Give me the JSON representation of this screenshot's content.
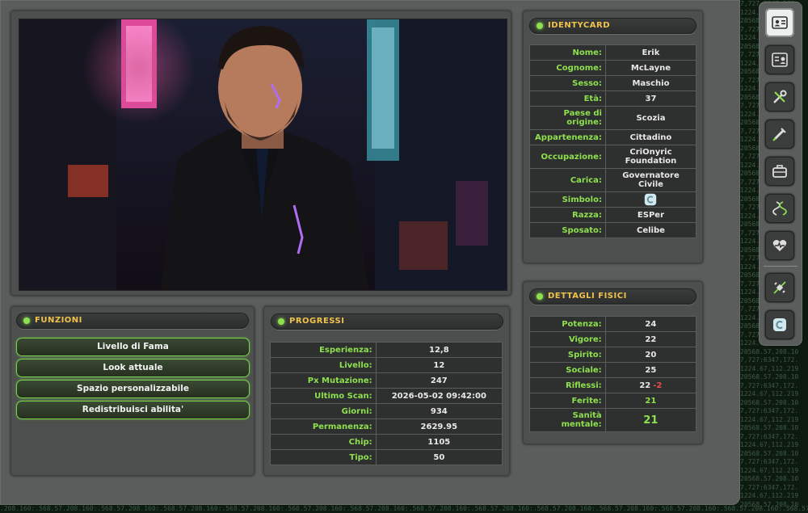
{
  "matrix": {
    "right_lines": [
      "7,727:6347,172.",
      "1224.67,112.219",
      "20568.57.208.10",
      "7,727:6347,172.",
      "1224.67,112.219",
      "20568.57.208.10",
      "7,727:6347,172.",
      "1224.67,112.219",
      "20568.57.208.10",
      "7,727:6347,172.",
      "1224.67,112.219",
      "20568.57.208.10",
      "7,727:6347,172.",
      "1224.67,112.219",
      "20568.57.208.10",
      "7,727:6347,172.",
      "1224.67,112.219",
      "20568.57.208.10",
      "7,727:6347,172.",
      "1224.67,112.219",
      "20568.57.208.10",
      "7,727:6347,172.",
      "1224.67,112.219",
      "20568.57.208.10",
      "7,727:6347,172.",
      "1224.67,112.219",
      "20568.57.208.10",
      "7,727:6347,172.",
      "1224.67,112.219",
      "20568.57.208.10",
      "7,727:6347,172.",
      "1224.67,112.219",
      "20568.57.208.10",
      "7,727:6347,172.",
      "1224.67,112.219",
      "20568.57.208.10",
      "7,727:6347,172.",
      "1224.67,112.219",
      "20568.57.208.10",
      "7,727:6347,172.",
      "1224.67,112.219",
      "20568.57.208.10",
      "7,727:6347,172.",
      "1224.67,112.219",
      "20568.57.208.10",
      "7,727:6347,172.",
      "1224.67,112.219",
      "20568.57.208.10",
      "7,727:6347,172.",
      "1224.67,112.219",
      "20568.57.208.10",
      "7,727:6347,172.",
      "1224.67,112.219",
      "20568.57.208.10",
      "7,727:6347,172.",
      "1224.67,112.219",
      "20568.57.208.10",
      "7,727:6347,172.",
      "1224.67,112.219",
      "20568.57.208.10"
    ],
    "bottom_line": ".208.160:.568.57.208.160:.568.57.208.160:.568.57.208.160:.568.57.208.160:.568.57.208.160:.568.57.208.160:.568.57.208.160:.568.57.208.160:.568.57.208.160:.568.57.208.160:.568.57.208.160:.568.57.208.160:.568.57.208.160:.568.57.208.160:.568.57.208.160:"
  },
  "identity": {
    "title": "IDENTYCARD",
    "rows": [
      {
        "label": "Nome:",
        "value": "Erik"
      },
      {
        "label": "Cognome:",
        "value": "McLayne"
      },
      {
        "label": "Sesso:",
        "value": "Maschio"
      },
      {
        "label": "Età:",
        "value": "37"
      },
      {
        "label": "Paese di origine:",
        "value": "Scozia"
      },
      {
        "label": "Appartenenza:",
        "value": "Cittadino"
      },
      {
        "label": "Occupazione:",
        "value": "CriOnyric Foundation"
      },
      {
        "label": "Carica:",
        "value": "Governatore Civile"
      },
      {
        "label": "Simbolo:",
        "value": "",
        "icon": "symbol-icon"
      },
      {
        "label": "Razza:",
        "value": "ESPer"
      },
      {
        "label": "Sposato:",
        "value": "Celibe"
      }
    ]
  },
  "functions": {
    "title": "FUNZIONI",
    "buttons": [
      "Livello di Fama",
      "Look attuale",
      "Spazio personalizzabile",
      "Redistribuisci abilita'"
    ]
  },
  "progress": {
    "title": "PROGRESSI",
    "rows": [
      {
        "label": "Esperienza:",
        "value": "12,8"
      },
      {
        "label": "Livello:",
        "value": "12"
      },
      {
        "label": "Px Mutazione:",
        "value": "247"
      },
      {
        "label": "Ultimo Scan:",
        "value": "2026-05-02 09:42:00"
      },
      {
        "label": "Giorni:",
        "value": "934"
      },
      {
        "label": "Permanenza:",
        "value": "2629.95"
      },
      {
        "label": "Chip:",
        "value": "1105"
      },
      {
        "label": "Tipo:",
        "value": "50"
      }
    ]
  },
  "physical": {
    "title": "DETTAGLI FISICI",
    "rows": [
      {
        "label": "Potenza:",
        "value": "24"
      },
      {
        "label": "Vigore:",
        "value": "22"
      },
      {
        "label": "Spirito:",
        "value": "20"
      },
      {
        "label": "Sociale:",
        "value": "25"
      },
      {
        "label": "Riflessi:",
        "value": "22",
        "modifier": "-2"
      },
      {
        "label": "Ferite:",
        "value": "21"
      },
      {
        "label": "Sanità mentale:",
        "value": "21"
      }
    ]
  },
  "sidebar": {
    "icons": [
      "id-card-icon",
      "id-badge-icon",
      "tools-icon",
      "syringe-icon",
      "briefcase-icon",
      "dna-icon",
      "heart-pulse-icon",
      "satellite-icon",
      "symbol-icon"
    ]
  },
  "colors": {
    "accent_green": "#8fe04f",
    "title_yellow": "#f1c24b",
    "panel_gray": "#5a5d5c",
    "cell_dark": "#2e302f",
    "modifier_red": "#e84b4b"
  }
}
